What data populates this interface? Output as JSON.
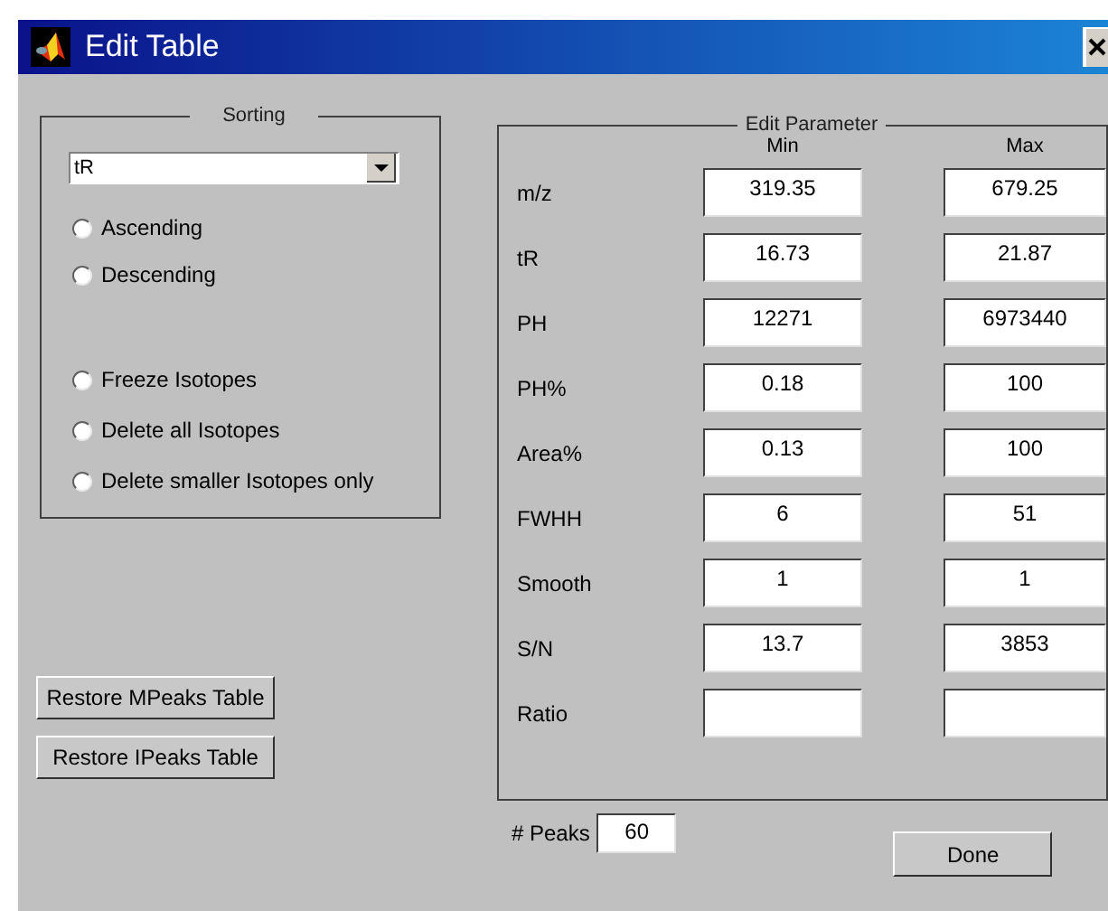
{
  "window": {
    "title": "Edit Table"
  },
  "sorting": {
    "title": "Sorting",
    "dropdown": {
      "value": "tR"
    },
    "order_options": [
      {
        "label": "Ascending",
        "checked": false
      },
      {
        "label": "Descending",
        "checked": false
      }
    ],
    "isotope_options": [
      {
        "label": "Freeze Isotopes",
        "checked": false
      },
      {
        "label": "Delete all Isotopes",
        "checked": false
      },
      {
        "label": "Delete smaller Isotopes only",
        "checked": false
      }
    ]
  },
  "buttons": [
    "Restore MPeaks Table",
    "Restore IPeaks Table"
  ],
  "edit_parameter": {
    "title": "Edit Parameter",
    "columns": [
      "Min",
      "Max"
    ],
    "rows": [
      {
        "label": "m/z",
        "min": "319.35",
        "max": "679.25"
      },
      {
        "label": "tR",
        "min": "16.73",
        "max": "21.87"
      },
      {
        "label": "PH",
        "min": "12271",
        "max": "6973440"
      },
      {
        "label": "PH%",
        "min": "0.18",
        "max": "100"
      },
      {
        "label": "Area%",
        "min": "0.13",
        "max": "100"
      },
      {
        "label": "FWHH",
        "min": "6",
        "max": "51"
      },
      {
        "label": "Smooth",
        "min": "1",
        "max": "1"
      },
      {
        "label": "S/N",
        "min": "13.7",
        "max": "3853"
      },
      {
        "label": "Ratio",
        "min": "",
        "max": ""
      }
    ]
  },
  "peaks": {
    "label": "# Peaks",
    "value": "60"
  },
  "done_button": "Done"
}
